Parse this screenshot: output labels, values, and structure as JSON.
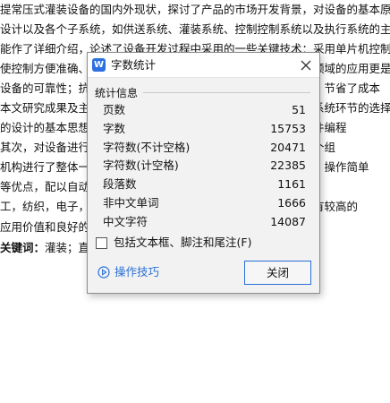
{
  "document": {
    "lines": [
      {
        "text": "提常压式灌装设备的国内外现状，探讨了产品的市场开发背景，对设备的基本原理、总"
      },
      {
        "text": "设计以及各个子系统，如供送系统、灌装系统、控制控制系统以及执行系统的主要"
      },
      {
        "text": "能作了详细介绍，论述了设备开发过程中采用的一些关键技术：采用单片机控制，主要"
      },
      {
        "text": "使控制方便准确、稳定，控制方便，相对传统的控制方式在灌装领域的应用更是提高"
      },
      {
        "text": "设备的可靠性；抗干扰能力，可实现自动化生产，降低生产成本，节省了成本"
      },
      {
        "text": "本文研究成果及主要内容包括以下几个方面，对灌装设备各个子系统环节的选择"
      },
      {
        "text": "的设计的基本思想和步骤，分析了各部分结构，对机械设计和软件编程"
      },
      {
        "text": "其次，对设备进行了系统的分析，完成了灌装设备控制系统的各个组"
      },
      {
        "text": "机构进行了整体一致性的设计，本设备具有结构简单，运行可靠、操作简单"
      },
      {
        "text": "等优点，配以自动式供瓶，适用于饮料、食品，医药，轻工，化"
      },
      {
        "text": "工，纺织，电子，仪表等行业，提高生产效率，节省劳动力，具有较高的"
      },
      {
        "text": "应用价值和良好的市场前景。"
      },
      {
        "keyword_label": "关键词：",
        "text": "灌装；直线式；单片机"
      }
    ]
  },
  "dialog": {
    "title": "字数统计",
    "app_icon_letter": "W",
    "close_icon": "close-icon",
    "group_label": "统计信息",
    "stats": [
      {
        "label": "页数",
        "value": "51"
      },
      {
        "label": "字数",
        "value": "15753"
      },
      {
        "label": "字符数(不计空格)",
        "value": "20471"
      },
      {
        "label": "字符数(计空格)",
        "value": "22385"
      },
      {
        "label": "段落数",
        "value": "1161"
      },
      {
        "label": "非中文单词",
        "value": "1666"
      },
      {
        "label": "中文字符",
        "value": "14087"
      }
    ],
    "checkbox_label": "包括文本框、脚注和尾注(F)",
    "checkbox_checked": false,
    "tips_label": "操作技巧",
    "close_button_label": "关闭",
    "accent_color": "#2a6fd6",
    "app_icon_color": "#2b6fe0"
  }
}
